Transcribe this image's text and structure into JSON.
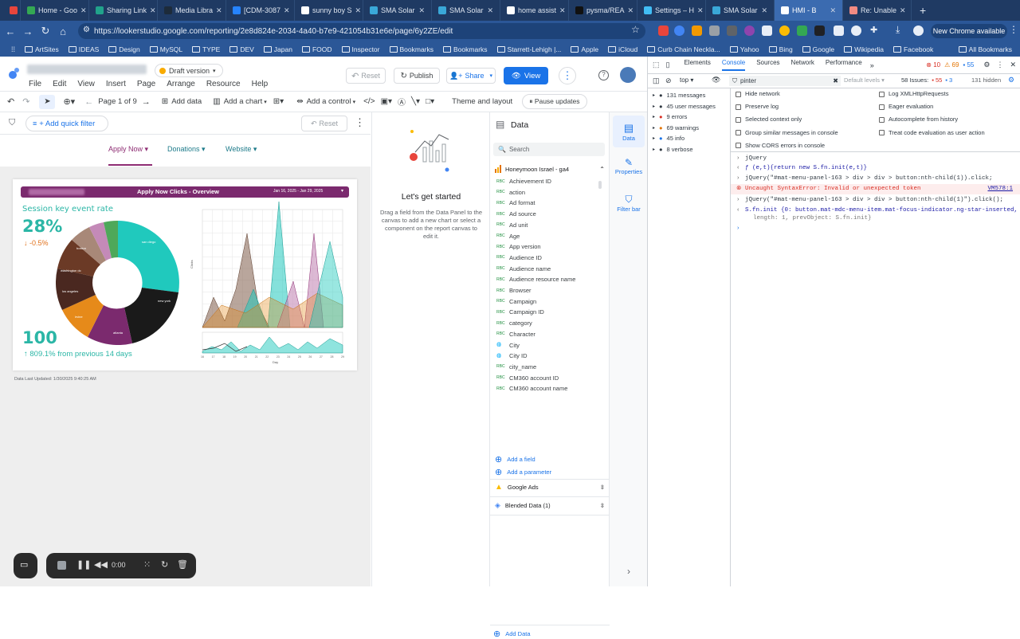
{
  "tabs": [
    {
      "title": "",
      "icon": "youtube-icon",
      "color": "#e8453c"
    },
    {
      "title": "Home - Goo",
      "icon": "drive-icon",
      "color": "#34a853"
    },
    {
      "title": "Sharing Link",
      "icon": "link-icon",
      "color": "#21a38b"
    },
    {
      "title": "Media Libra",
      "icon": "media-icon",
      "color": "#1d2b3a"
    },
    {
      "title": "[CDM-3087",
      "icon": "jira-icon",
      "color": "#2684ff"
    },
    {
      "title": "sunny boy S",
      "icon": "google-icon",
      "color": "#ffffff"
    },
    {
      "title": "SMA Solar",
      "icon": "sma-icon",
      "color": "#3aa8d8"
    },
    {
      "title": "SMA Solar",
      "icon": "sma-icon",
      "color": "#3aa8d8"
    },
    {
      "title": "home assist",
      "icon": "google-icon",
      "color": "#ffffff"
    },
    {
      "title": "pysma/REA",
      "icon": "github-icon",
      "color": "#111111"
    },
    {
      "title": "Settings – H",
      "icon": "ha-icon",
      "color": "#41bdf5"
    },
    {
      "title": "SMA Solar",
      "icon": "sma-icon",
      "color": "#3aa8d8"
    },
    {
      "title": "HMI - B",
      "icon": "hmi-icon",
      "color": "#ffffff"
    },
    {
      "title": "Re: Unable",
      "icon": "forum-icon",
      "color": "#f28b82"
    }
  ],
  "url": "https://lookerstudio.google.com/reporting/2e8d824e-2034-4a40-b7e9-421054b31e6e/page/6y2ZE/edit",
  "new_chrome": "New Chrome available",
  "bookmarks": [
    "ArtSites",
    "IDEAS",
    "Design",
    "MySQL",
    "TYPE",
    "DEV",
    "Japan",
    "FOOD",
    "Inspector",
    "Bookmarks",
    "Bookmarks",
    "Starrett-Lehigh |...",
    "Apple",
    "iCloud",
    "Curb Chain Neckla...",
    "Yahoo",
    "Bing",
    "Google",
    "Wikipedia",
    "Facebook"
  ],
  "all_bookmarks": "All Bookmarks",
  "looker": {
    "draft": "Draft version",
    "menus": [
      "File",
      "Edit",
      "View",
      "Insert",
      "Page",
      "Arrange",
      "Resource",
      "Help"
    ],
    "reset": "Reset",
    "publish": "Publish",
    "share": "Share",
    "view": "View",
    "page_indicator": "Page 1 of 9",
    "tools": [
      "Add data",
      "Add a chart",
      "Add a control",
      "Theme and layout",
      "Pause updates"
    ],
    "add_quick_filter": "+ Add quick filter",
    "filter_reset": "Reset",
    "nav": [
      "Apply Now",
      "Donations",
      "Website"
    ],
    "report_title": "Apply Now Clicks - Overview",
    "report_dates": "Jan 16, 2025 - Jan 29, 2025",
    "kpi_label": "Session key event rate",
    "kpi_value": "28%",
    "kpi_delta": "↓ -0.5%",
    "kpi2_value": "100",
    "kpi2_delta": "↑ 809.1% from previous 14 days",
    "last_updated": "Data Last Updated: 1/30/2025 9:40:25 AM",
    "donut_labels": [
      "san diego",
      "new york",
      "atlanta",
      "irvine",
      "los angeles",
      "washington dc",
      "boston"
    ],
    "y_axis": "Clicks",
    "x_axis": "Day",
    "x_ticks": [
      "16",
      "17",
      "18",
      "19",
      "20",
      "21",
      "22",
      "23",
      "24",
      "25",
      "26",
      "27",
      "28",
      "29"
    ],
    "getting_started_title": "Let's get started",
    "getting_started_body": "Drag a field from the Data Panel to the canvas to add a new chart or select a component on the report canvas to edit it."
  },
  "data_panel": {
    "title": "Data",
    "search": "Search",
    "source": "Honeymoon Israel - ga4",
    "fields": [
      "Achievement ID",
      "action",
      "Ad format",
      "Ad source",
      "Ad unit",
      "Age",
      "App version",
      "Audience ID",
      "Audience name",
      "Audience resource name",
      "Browser",
      "Campaign",
      "Campaign ID",
      "category",
      "Character",
      "City",
      "City ID",
      "city_name",
      "CM360 account ID",
      "CM360 account name"
    ],
    "add_field": "Add a field",
    "add_param": "Add a parameter",
    "sources": [
      "Google Ads",
      "Blended Data (1)"
    ],
    "add_data": "Add Data"
  },
  "rail": [
    "Data",
    "Properties",
    "Filter bar"
  ],
  "devtools": {
    "tabs": [
      "Elements",
      "Console",
      "Sources",
      "Network",
      "Performance"
    ],
    "counts": {
      "errors": "10",
      "warnings": "69",
      "info": "55"
    },
    "context": "top",
    "filter": "pinter",
    "levels": "Default levels",
    "issues": "58 Issues:",
    "issue_errors": "55",
    "issue_info": "3",
    "hidden": "131 hidden",
    "sidebar": [
      "131 messages",
      "45 user messages",
      "9 errors",
      "69 warnings",
      "45 info",
      "8 verbose"
    ],
    "settings_left": [
      "Hide network",
      "Preserve log",
      "Selected context only",
      "Group similar messages in console",
      "Show CORS errors in console"
    ],
    "settings_right": [
      "Log XMLHttpRequests",
      "Eager evaluation",
      "Autocomplete from history",
      "Treat code evaluation as user action"
    ],
    "console": [
      {
        "text": "jQuery",
        "type": "input"
      },
      {
        "text": "ƒ (e,t){return new S.fn.init(e,t)}",
        "type": "output"
      },
      {
        "text": "jQuery(\"#mat-menu-panel-163 > div > div > button:nth-child(1)).click;",
        "type": "input"
      },
      {
        "text": "Uncaught SyntaxError: Invalid or unexpected token",
        "type": "error",
        "src": "VM578:1"
      },
      {
        "text": "jQuery(\"#mat-menu-panel-163 > div > div > button:nth-child(1)\").click();",
        "type": "input"
      },
      {
        "text": "S.fn.init {0: button.mat-mdc-menu-item.mat-focus-indicator.ng-star-inserted,",
        "type": "output"
      },
      {
        "text": "length: 1, prevObject: S.fn.init}",
        "type": "output2"
      }
    ]
  },
  "recorder": {
    "time": "0:00"
  }
}
